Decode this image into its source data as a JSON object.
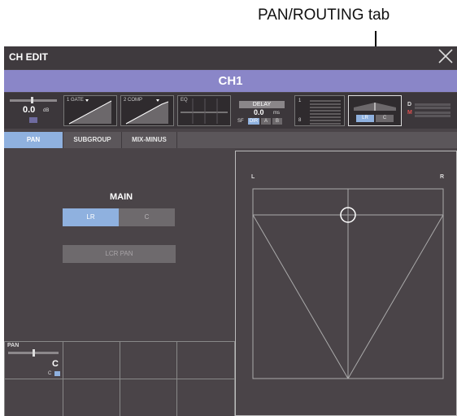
{
  "callout": {
    "label": "PAN/ROUTING tab"
  },
  "window": {
    "title": "CH EDIT",
    "close_icon": "close-icon"
  },
  "channel": {
    "name": "CH1"
  },
  "modules": {
    "fader": {
      "value": "0.0",
      "unit": "dB"
    },
    "gate": {
      "label": "1 GATE"
    },
    "comp": {
      "label": "2 COMP"
    },
    "eq": {
      "label": "EQ"
    },
    "delay": {
      "label": "DELAY",
      "value": "0.0",
      "unit": "ms",
      "buttons": [
        "SF",
        "DIR",
        "A",
        "B"
      ]
    },
    "aux": {
      "top": "1",
      "bottom": "8"
    },
    "panrouting": {
      "lr": "LR",
      "c": "C"
    },
    "dm": {
      "d": "D",
      "m": "M"
    }
  },
  "tabs": [
    {
      "label": "PAN",
      "active": true
    },
    {
      "label": "SUBGROUP",
      "active": false
    },
    {
      "label": "MIX-MINUS",
      "active": false
    }
  ],
  "main": {
    "heading": "MAIN",
    "lr_button": "LR",
    "c_button": "C",
    "lcr_pan_button": "LCR PAN"
  },
  "panpad": {
    "left": "L",
    "right": "R"
  },
  "knob": {
    "label": "PAN",
    "value": "C",
    "sub": "C"
  }
}
